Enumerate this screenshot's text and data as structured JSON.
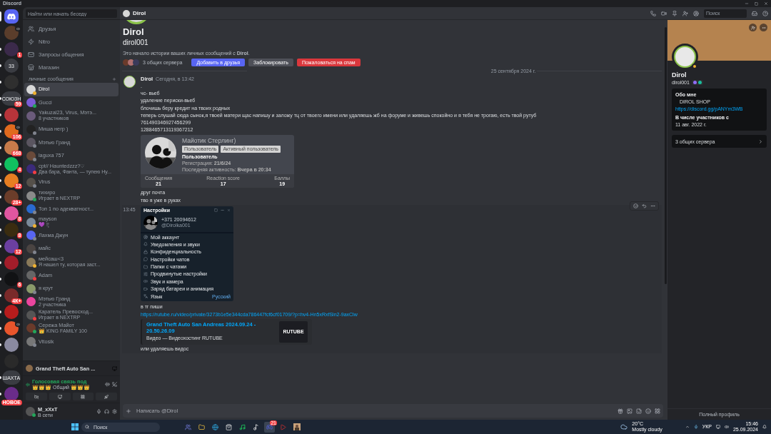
{
  "window": {
    "title": "Discord"
  },
  "servers": [
    {
      "kind": "home",
      "selected": true,
      "unread": false
    },
    {
      "kind": "server",
      "selected": false,
      "unread": false,
      "speaker": true
    },
    {
      "kind": "server",
      "selected": false,
      "unread": true,
      "badge": "1"
    },
    {
      "kind": "server",
      "selected": false,
      "unread": true,
      "label": "33"
    },
    {
      "kind": "server",
      "selected": false,
      "unread": true
    },
    {
      "kind": "server",
      "selected": false,
      "unread": true,
      "label": "СОЮЗН",
      "badge": "59"
    },
    {
      "kind": "server",
      "selected": false,
      "unread": true
    },
    {
      "kind": "server",
      "selected": false,
      "unread": true,
      "badge": "106",
      "speaker": true
    },
    {
      "kind": "server",
      "selected": false,
      "unread": true,
      "badge": "668"
    },
    {
      "kind": "server",
      "selected": false,
      "unread": true,
      "badge": "4"
    },
    {
      "kind": "server",
      "selected": false,
      "unread": true,
      "badge": "12"
    },
    {
      "kind": "server",
      "selected": false,
      "unread": true,
      "badge": "28+"
    },
    {
      "kind": "server",
      "selected": false,
      "unread": true,
      "badge": "8"
    },
    {
      "kind": "server",
      "selected": false,
      "unread": true,
      "badge": "8"
    },
    {
      "kind": "server",
      "selected": false,
      "unread": true,
      "badge": "12"
    },
    {
      "kind": "server",
      "selected": false,
      "unread": true
    },
    {
      "kind": "server",
      "selected": false,
      "unread": true,
      "badge": "6"
    },
    {
      "kind": "server",
      "selected": false,
      "unread": true,
      "badge": "4К+"
    },
    {
      "kind": "server",
      "selected": false,
      "unread": true
    },
    {
      "kind": "server",
      "selected": false,
      "unread": true,
      "speaker": true
    },
    {
      "kind": "server",
      "selected": false,
      "unread": true
    },
    {
      "kind": "server",
      "selected": false,
      "unread": false
    },
    {
      "kind": "server",
      "selected": false,
      "unread": true,
      "label": "ШАХТА"
    },
    {
      "kind": "server",
      "selected": false,
      "unread": true,
      "badge": "НОВОЕ"
    }
  ],
  "dm_sidebar": {
    "search_placeholder": "Найти или начать беседу",
    "nav": [
      {
        "label": "Друзья"
      },
      {
        "label": "Nitro"
      },
      {
        "label": "Запросы общения"
      },
      {
        "label": "Магазин"
      }
    ],
    "section_title": "личные сообщения",
    "conversations": [
      {
        "name": "Dirol",
        "color": "#f0b232",
        "selected": true
      },
      {
        "name": "Gucci",
        "color": "#23a55a",
        "selected": false
      },
      {
        "name": "Yakuzal23, Virus, Мэтэ...",
        "subtitle": "8 участников",
        "selected": false
      },
      {
        "name": "Миша негр )",
        "color": "#80848e",
        "selected": false
      },
      {
        "name": "Мэтью Гранд",
        "color": "#80848e",
        "selected": false
      },
      {
        "name": "laguxa 757",
        "color": "#80848e",
        "selected": false
      },
      {
        "name": "cpt// Hauntedzzz?♡",
        "subtitle": "Два бара, Фанта, — тупею Ну...",
        "color": "#f23f43",
        "selected": false
      },
      {
        "name": "Virus",
        "color": "#80848e",
        "selected": false
      },
      {
        "name": "тихиро",
        "subtitle": "Играет в NEXTRP",
        "color": "#23a55a",
        "selected": false
      },
      {
        "name": "Топ 1 по адекватност...",
        "color": "#80848e",
        "selected": false
      },
      {
        "name": "mayson",
        "subtitle": "💜 !¦",
        "color": "#f0b232",
        "selected": false
      },
      {
        "name": "Лахма Джун",
        "color": "#80848e",
        "selected": false
      },
      {
        "name": "майс",
        "color": "#80848e",
        "selected": false
      },
      {
        "name": "мейсаш<3",
        "subtitle": "Я нашел ту, которая заст...",
        "color": "#f0b232",
        "selected": false
      },
      {
        "name": "Adam",
        "color": "#f23f43",
        "selected": false
      },
      {
        "name": "я крут",
        "color": "#80848e",
        "selected": false
      },
      {
        "name": "Мэтью Гранд",
        "subtitle": "2 участника",
        "selected": false
      },
      {
        "name": "Каратель Превосход...",
        "subtitle": "Играет в NEXTRP",
        "color": "#f23f43",
        "selected": false
      },
      {
        "name": "Сережа Майот",
        "subtitle": "👑 KING FAMILY 100",
        "color": "#23a55a",
        "selected": false
      },
      {
        "name": "Vitosik",
        "color": "#80848e",
        "selected": false
      }
    ]
  },
  "activity": {
    "title": "Grand Theft Auto San ..."
  },
  "voice": {
    "status": "Голосовая связь под",
    "channel": "👑👑👑 Общий 👑👑👑"
  },
  "user": {
    "name": "M_xXxT",
    "status": "В сети"
  },
  "header": {
    "title": "Dirol",
    "search_placeholder": "Поиск"
  },
  "intro": {
    "display_name": "Dirol",
    "username": "dirol001",
    "text": "Это начало истории ваших личных сообщений с **Dirol**.",
    "mutual": "3 общих сервера",
    "buttons": [
      {
        "label": "Добавить в друзья",
        "kind": "primary"
      },
      {
        "label": "Заблокировать",
        "kind": "secondary"
      },
      {
        "label": "Пожаловаться на спам",
        "kind": "danger"
      }
    ]
  },
  "date_divider": "25 сентября 2024 г.",
  "messages": [
    {
      "author": "Dirol",
      "time": "Сегодня, в 13:42",
      "hovered": false,
      "blocks": [
        {
          "kind": "text",
          "text": "."
        },
        {
          "kind": "text",
          "text": "чс- вьеб"
        },
        {
          "kind": "text",
          "text": "удаление периски-вьеб"
        },
        {
          "kind": "text",
          "text": "блочишь беру кредит на твоих родных"
        },
        {
          "kind": "text",
          "text": "теперь слушай сюда сынок,я твоей матери щас напишу и заложу тц от твоего имени или удаляешь жб на форуме и живешь спокойно и я тебя не трогаю, есть твой рутуб"
        },
        {
          "kind": "text",
          "text": "761490346927456299"
        },
        {
          "kind": "text",
          "text": "1288465713119367212"
        },
        {
          "kind": "forum_card",
          "title": "Майотик Стерлинг)",
          "tags": [
            "Пользователь",
            "Активный пользователь"
          ],
          "role": "Пользователь",
          "facts": [
            {
              "label": "Регистрация:",
              "value": "21/6/24"
            },
            {
              "label": "Последняя активность:",
              "value": "Вчера в 20:34"
            }
          ],
          "stats": [
            {
              "label": "Сообщения",
              "value": "21"
            },
            {
              "label": "Reaction score",
              "value": "17"
            },
            {
              "label": "Баллы",
              "value": "19"
            }
          ]
        },
        {
          "kind": "text",
          "text": "друг почта"
        },
        {
          "kind": "text",
          "text": "тво я уже в руках"
        }
      ]
    },
    {
      "time": "13:45",
      "hovered": true,
      "blocks": [
        {
          "kind": "telegram",
          "title": "Настройки",
          "phone": "+371 20094612",
          "handle": "@Dirolka001",
          "items": [
            {
              "label": "Мой аккаунт"
            },
            {
              "label": "Уведомления и звуки"
            },
            {
              "label": "Конфиденциальность"
            },
            {
              "label": "Настройки чатов"
            },
            {
              "label": "Папки с чатами"
            },
            {
              "label": "Продвинутые настройки"
            },
            {
              "label": "Звук и камера"
            },
            {
              "label": "Заряд батареи и анимация"
            },
            {
              "label": "Язык",
              "value": "Русский"
            }
          ]
        },
        {
          "kind": "text",
          "text": "в тг пиши"
        },
        {
          "kind": "link",
          "text": "https://rutube.ru/video/private/3273b1e5e344cda786447fcf6cf01709/?p=hv4-Hn5xRxfSin2-9axClw"
        },
        {
          "kind": "embed",
          "title": "Grand Theft Auto  San Andreas 2024.09.24 - 20.50.26.09",
          "description": "Видео — Видеохостинг RUTUBE",
          "thumb": "RUTUBE"
        },
        {
          "kind": "text",
          "text": "или удаляешь видос"
        }
      ]
    }
  ],
  "composer": {
    "placeholder": "Написать @Dirol"
  },
  "profile": {
    "display_name": "Dirol",
    "username": "dirol001",
    "about_title": "Обо мне",
    "about_text": "DIROL SHOP",
    "about_link": "https://discord.gg/pANYm3WB",
    "member_since_title": "В числе участников с",
    "member_since": "11 авг. 2022 г.",
    "mutual": "3 общих сервера",
    "full_profile": "Полный профиль"
  },
  "taskbar": {
    "search_placeholder": "Поиск",
    "apps": [
      {
        "active": false
      },
      {
        "active": false
      },
      {
        "active": false
      },
      {
        "active": false
      },
      {
        "active": false
      },
      {
        "active": false
      },
      {
        "active": true,
        "badge": "21"
      },
      {
        "active": false
      },
      {
        "active": false
      }
    ],
    "temperature": "20°C",
    "weather": "Mostly cloudy",
    "language": "УКР",
    "time": "15:46",
    "date": "25.09.2024"
  }
}
